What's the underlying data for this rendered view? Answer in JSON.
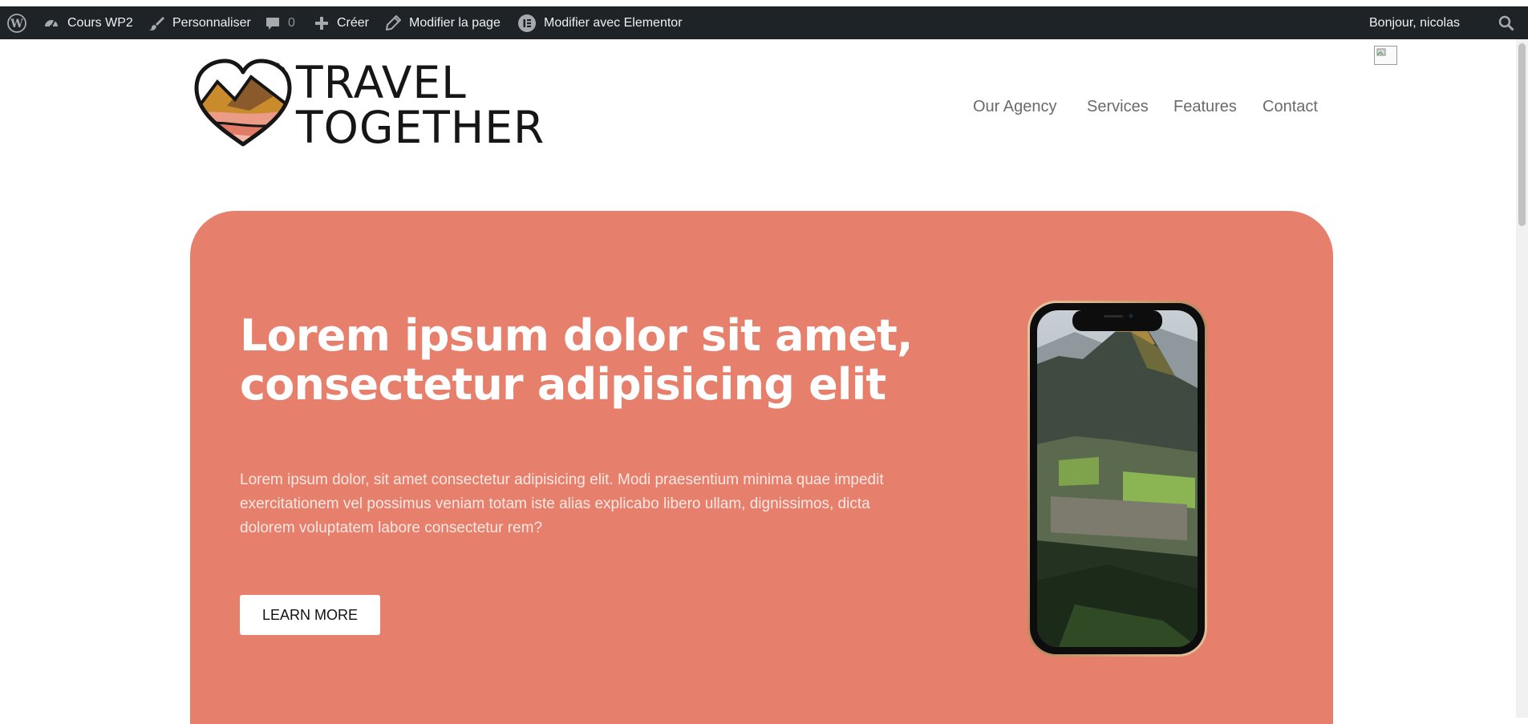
{
  "admin_bar": {
    "site_name": "Cours WP2",
    "customize": "Personnaliser",
    "comments_count": "0",
    "new": "Créer",
    "edit_page": "Modifier la page",
    "edit_elementor": "Modifier avec Elementor",
    "greeting": "Bonjour, nicolas"
  },
  "header": {
    "logo_line1": "TRAVEL",
    "logo_line2": "TOGETHER",
    "nav": [
      "Our Agency",
      "Services",
      "Features",
      "Contact"
    ]
  },
  "hero": {
    "title_line1": "Lorem ipsum dolor sit amet,",
    "title_line2": "consectetur adipisicing elit",
    "body_line1": "Lorem ipsum dolor, sit amet consectetur adipisicing elit. Modi praesentium minima quae impedit",
    "body_line2": "exercitationem vel possimus veniam totam iste alias explicabo libero ullam, dignissimos, dicta",
    "body_line3": "dolorem voluptatem labore consectetur rem?",
    "cta_label": "LEARN MORE"
  },
  "colors": {
    "admin_bar_bg": "#1d2327",
    "hero_bg": "#e67f6b",
    "nav_text": "#6a6a6a"
  },
  "icons": [
    "wordpress-icon",
    "dashboard-icon",
    "brush-icon",
    "comment-icon",
    "plus-icon",
    "pencil-icon",
    "elementor-icon",
    "search-icon",
    "broken-image-icon",
    "heart-mountain-logo-icon",
    "phone-mockup"
  ]
}
